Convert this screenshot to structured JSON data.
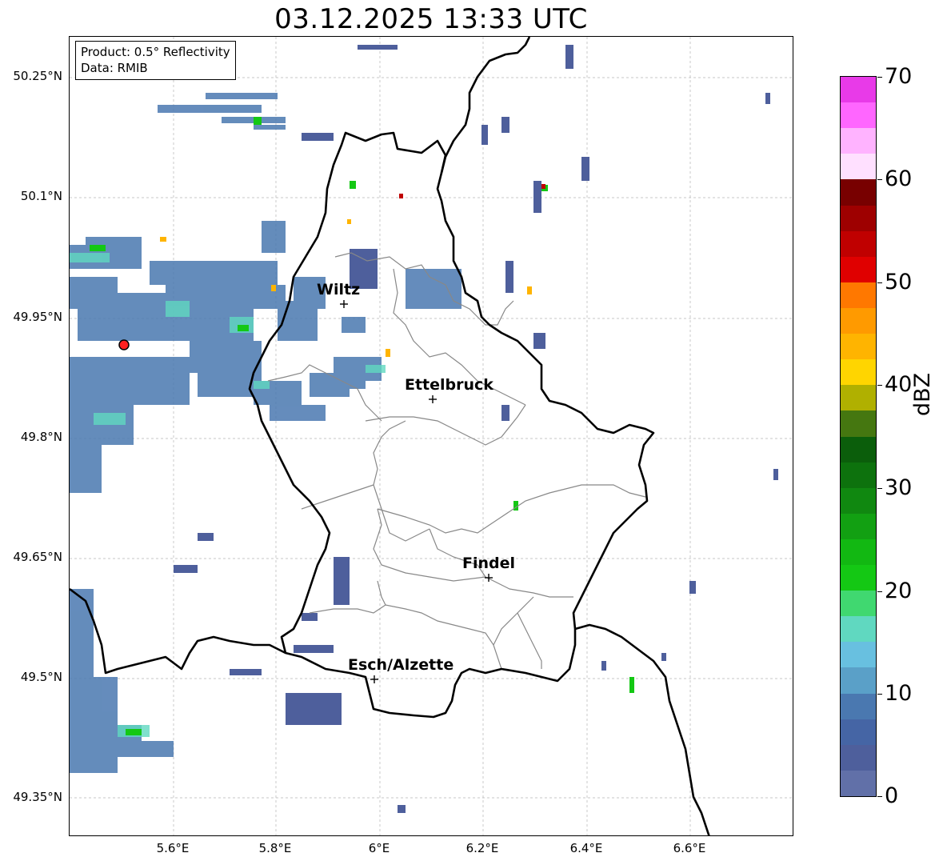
{
  "title": "03.12.2025 13:33 UTC",
  "info": {
    "product": "Product: 0.5° Reflectivity",
    "data": "Data: RMIB"
  },
  "y_ticks": [
    "50.25°N",
    "50.1°N",
    "49.95°N",
    "49.8°N",
    "49.65°N",
    "49.5°N",
    "49.35°N"
  ],
  "x_ticks": [
    "5.6°E",
    "5.8°E",
    "6°E",
    "6.2°E",
    "6.4°E",
    "6.6°E"
  ],
  "cities": [
    {
      "name": "Wiltz"
    },
    {
      "name": "Ettelbruck"
    },
    {
      "name": "Findel"
    },
    {
      "name": "Esch/Alzette"
    }
  ],
  "colorbar": {
    "title": "dBZ",
    "labels": [
      "70",
      "60",
      "50",
      "40",
      "30",
      "20",
      "10",
      "0"
    ],
    "colors_top_to_bottom": [
      "#e83ae8",
      "#ff66ff",
      "#ffb3ff",
      "#ffe0ff",
      "#780000",
      "#9e0000",
      "#c00000",
      "#e00000",
      "#ff7800",
      "#ff9a00",
      "#ffb400",
      "#ffd500",
      "#b0b000",
      "#457710",
      "#0b5e0b",
      "#0d720d",
      "#108810",
      "#12a012",
      "#12b812",
      "#14c814",
      "#40d870",
      "#60d8c0",
      "#68c0e0",
      "#5aa0c8",
      "#4a78b0",
      "#4565a5",
      "#4e5f9c",
      "#6170a8"
    ]
  },
  "radar_color": "#ff2020"
}
